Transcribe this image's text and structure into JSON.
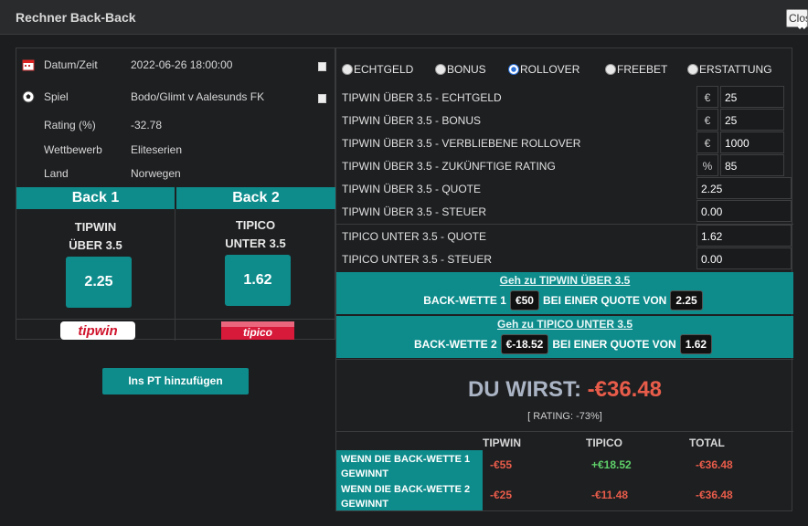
{
  "window": {
    "title": "Rechner Back-Back",
    "close_label": "Close"
  },
  "event": {
    "rows": [
      {
        "label": "Datum/Zeit",
        "value": "2022-06-26 18:00:00"
      },
      {
        "label": "Spiel",
        "value": "Bodo/Glimt v Aalesunds FK"
      },
      {
        "label": "Rating (%)",
        "value": "-32.78"
      },
      {
        "label": "Wettbewerb",
        "value": "Eliteserien"
      },
      {
        "label": "Land",
        "value": "Norwegen"
      }
    ]
  },
  "backs": [
    {
      "header": "Back 1",
      "bookmaker": "TIPWIN",
      "market": "ÜBER 3.5",
      "odds": "2.25",
      "logo": "tipwin"
    },
    {
      "header": "Back 2",
      "bookmaker": "TIPICO",
      "market": "UNTER 3.5",
      "odds": "1.62",
      "logo": "tipico"
    }
  ],
  "pt_button": "Ins PT hinzufügen",
  "bet_types": [
    {
      "label": "ECHTGELD",
      "selected": false
    },
    {
      "label": "BONUS",
      "selected": false
    },
    {
      "label": "ROLLOVER",
      "selected": true
    },
    {
      "label": "FREEBET",
      "selected": false
    },
    {
      "label": "ERSTATTUNG",
      "selected": false
    }
  ],
  "fields": [
    {
      "label": "TIPWIN ÜBER 3.5 - ECHTGELD",
      "unit": "€",
      "value": "25"
    },
    {
      "label": "TIPWIN ÜBER 3.5 - BONUS",
      "unit": "€",
      "value": "25"
    },
    {
      "label": "TIPWIN ÜBER 3.5 - VERBLIEBENE ROLLOVER",
      "unit": "€",
      "value": "1000"
    },
    {
      "label": "TIPWIN ÜBER 3.5 - ZUKÜNFTIGE RATING",
      "unit": "%",
      "value": "85"
    },
    {
      "label": "TIPWIN ÜBER 3.5 - QUOTE",
      "unit": "",
      "value": "2.25"
    },
    {
      "label": "TIPWIN ÜBER 3.5 - STEUER",
      "unit": "",
      "value": "0.00"
    },
    {
      "label": "TIPICO UNTER 3.5  - QUOTE",
      "unit": "",
      "value": "1.62"
    },
    {
      "label": "TIPICO UNTER 3.5 - STEUER",
      "unit": "",
      "value": "0.00"
    }
  ],
  "go_boxes": [
    {
      "link": "Geh zu TIPWIN ÜBER 3.5",
      "prefix": "BACK-WETTE 1",
      "stake": "€50",
      "mid": "BEI EINER QUOTE VON",
      "odds": "2.25"
    },
    {
      "link": "Geh zu TIPICO UNTER 3.5",
      "prefix": "BACK-WETTE 2",
      "stake": "€-18.52",
      "mid": "BEI EINER QUOTE VON",
      "odds": "1.62"
    }
  ],
  "result": {
    "prefix": "DU WIRST:",
    "amount": "-€36.48",
    "rating": "[ RATING: -73%]"
  },
  "table": {
    "headers": [
      "TIPWIN",
      "TIPICO",
      "TOTAL"
    ],
    "rows": [
      {
        "label": "WENN DIE BACK-WETTE 1 GEWINNT",
        "tipwin": "-€55",
        "tipico": "+€18.52",
        "total": "-€36.48"
      },
      {
        "label": "WENN DIE BACK-WETTE 2 GEWINNT",
        "tipwin": "-€25",
        "tipico": "-€11.48",
        "total": "-€36.48"
      }
    ]
  },
  "colors": {
    "accent": "#0e8c8c",
    "negative": "#e85c4a",
    "positive": "#5fd06a"
  }
}
